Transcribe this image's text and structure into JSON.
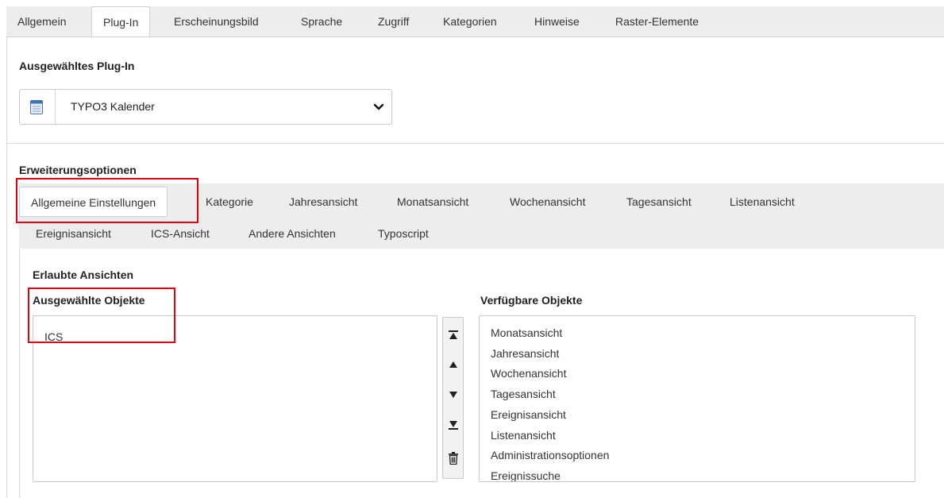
{
  "top_tabs": {
    "items": [
      {
        "label": "Allgemein"
      },
      {
        "label": "Plug-In"
      },
      {
        "label": "Erscheinungsbild"
      },
      {
        "label": "Sprache"
      },
      {
        "label": "Zugriff"
      },
      {
        "label": "Kategorien"
      },
      {
        "label": "Hinweise"
      },
      {
        "label": "Raster-Elemente"
      }
    ],
    "active": "Plug-In"
  },
  "plugin": {
    "heading": "Ausgewähltes Plug-In",
    "selected_value": "TYPO3 Kalender",
    "icon": "calendar-icon"
  },
  "extension": {
    "heading": "Erweiterungsoptionen",
    "tabs": [
      {
        "label": "Allgemeine Einstellungen"
      },
      {
        "label": "Kategorie"
      },
      {
        "label": "Jahresansicht"
      },
      {
        "label": "Monatsansicht"
      },
      {
        "label": "Wochenansicht"
      },
      {
        "label": "Tagesansicht"
      },
      {
        "label": "Listenansicht"
      },
      {
        "label": "Ereignisansicht"
      },
      {
        "label": "ICS-Ansicht"
      },
      {
        "label": "Andere Ansichten"
      },
      {
        "label": "Typoscript"
      }
    ],
    "active": "Allgemeine Einstellungen"
  },
  "allowed_views": {
    "heading": "Erlaubte Ansichten",
    "selected_label": "Ausgewählte Objekte",
    "available_label": "Verfügbare Objekte",
    "selected_items": [
      "ICS"
    ],
    "available_items": [
      "Monatsansicht",
      "Jahresansicht",
      "Wochenansicht",
      "Tagesansicht",
      "Ereignisansicht",
      "Listenansicht",
      "Administrationsoptionen",
      "Ereignissuche"
    ],
    "buttons": [
      "move-top-icon",
      "move-up-icon",
      "move-down-icon",
      "move-bottom-icon",
      "trash-icon"
    ]
  },
  "colors": {
    "highlight": "#e3000f",
    "tab_bar": "#ededed"
  }
}
